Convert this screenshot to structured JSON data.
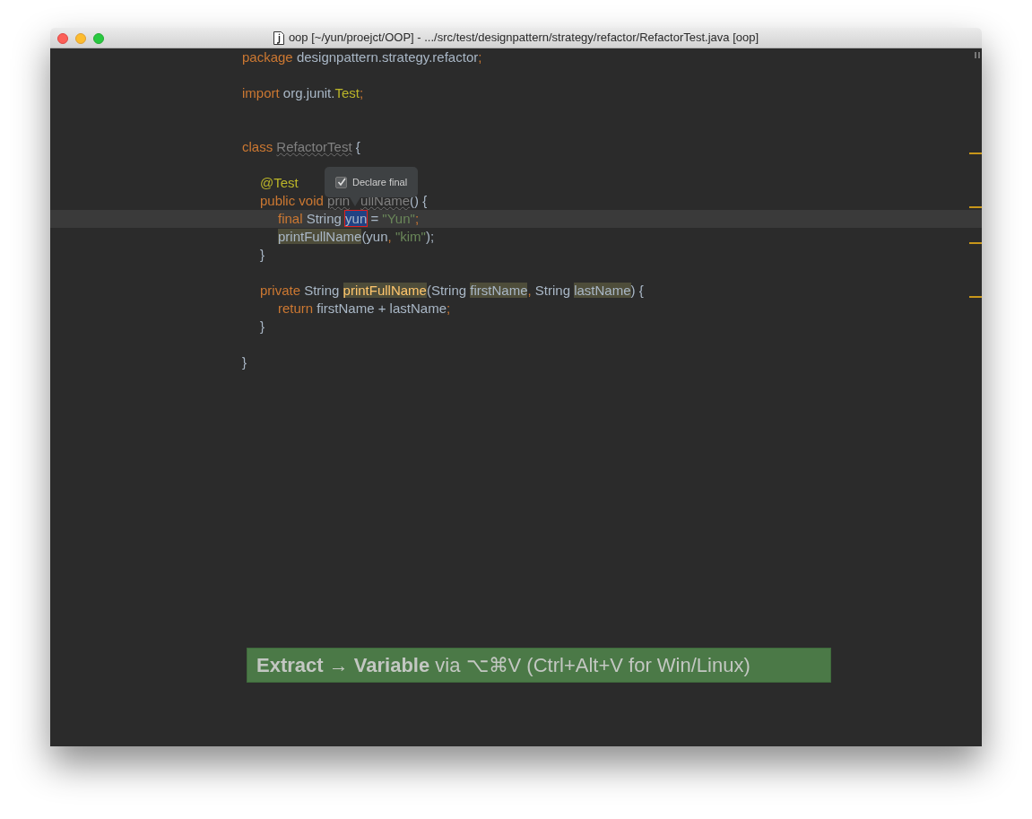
{
  "window": {
    "title": "oop [~/yun/proejct/OOP] - .../src/test/designpattern/strategy/refactor/RefactorTest.java [oop]"
  },
  "code_lines": [
    {
      "kind": "code",
      "tokens": [
        {
          "text": "package",
          "kind": "keyword"
        },
        {
          "text": " designpattern.strategy.refactor",
          "kind": "plain"
        },
        {
          "text": ";",
          "kind": "punct"
        }
      ]
    },
    {
      "kind": "blank"
    },
    {
      "kind": "code",
      "tokens": [
        {
          "text": "import",
          "kind": "keyword"
        },
        {
          "text": " org.junit.",
          "kind": "plain"
        },
        {
          "text": "Test",
          "kind": "annotation"
        },
        {
          "text": ";",
          "kind": "punct"
        }
      ]
    },
    {
      "kind": "blank"
    },
    {
      "kind": "blank"
    },
    {
      "kind": "code",
      "tokens": [
        {
          "text": "class ",
          "kind": "keyword"
        },
        {
          "text": "RefactorTest",
          "kind": "unused"
        },
        {
          "text": " {",
          "kind": "plain"
        }
      ],
      "children": [
        {
          "kind": "blank"
        },
        {
          "kind": "code",
          "tokens": [
            {
              "text": "@Test",
              "kind": "annotation"
            }
          ]
        },
        {
          "kind": "code",
          "tokens": [
            {
              "text": "public void ",
              "kind": "keyword"
            },
            {
              "text": "prin",
              "kind": "unused"
            },
            {
              "kind": "covered"
            },
            {
              "text": "ullName",
              "kind": "unused"
            },
            {
              "text": "() {",
              "kind": "plain"
            }
          ],
          "children": [
            {
              "kind": "code",
              "current": true,
              "tokens": [
                {
                  "text": "final",
                  "kind": "keyword"
                },
                {
                  "text": " String ",
                  "kind": "plain"
                },
                {
                  "text": "yun",
                  "kind": "selected"
                },
                {
                  "text": " = ",
                  "kind": "plain"
                },
                {
                  "text": "\"Yun\"",
                  "kind": "string"
                },
                {
                  "text": ";",
                  "kind": "punct"
                }
              ]
            },
            {
              "kind": "code",
              "tokens": [
                {
                  "text": "printFullName",
                  "kind": "usage"
                },
                {
                  "text": "(yun",
                  "kind": "plain"
                },
                {
                  "text": ", ",
                  "kind": "punct"
                },
                {
                  "text": "\"kim\"",
                  "kind": "string"
                },
                {
                  "text": ");",
                  "kind": "plain"
                }
              ]
            }
          ]
        },
        {
          "kind": "code",
          "tokens": [
            {
              "text": "}",
              "kind": "plain"
            }
          ]
        },
        {
          "kind": "blank"
        },
        {
          "kind": "code",
          "tokens": [
            {
              "text": "private",
              "kind": "keyword"
            },
            {
              "text": " String ",
              "kind": "plain"
            },
            {
              "text": "printFullName",
              "kind": "declaration"
            },
            {
              "text": "(String ",
              "kind": "plain"
            },
            {
              "text": "firstName",
              "kind": "usage"
            },
            {
              "text": ", ",
              "kind": "punct"
            },
            {
              "text": "String ",
              "kind": "plain"
            },
            {
              "text": "lastName",
              "kind": "usage"
            },
            {
              "text": ") {",
              "kind": "plain"
            }
          ],
          "children": [
            {
              "kind": "code",
              "tokens": [
                {
                  "text": "return",
                  "kind": "keyword"
                },
                {
                  "text": " firstName + lastName",
                  "kind": "plain"
                },
                {
                  "text": ";",
                  "kind": "punct"
                }
              ]
            }
          ]
        },
        {
          "kind": "code",
          "tokens": [
            {
              "text": "}",
              "kind": "plain"
            }
          ]
        }
      ]
    },
    {
      "kind": "blank"
    },
    {
      "kind": "code",
      "tokens": [
        {
          "text": "}",
          "kind": "plain"
        }
      ]
    }
  ],
  "popup": {
    "label": "Declare final",
    "checked": true
  },
  "tip": "**Extract → Variable** via ⌥⌘V (Ctrl+Alt+V for Win/Linux)"
}
